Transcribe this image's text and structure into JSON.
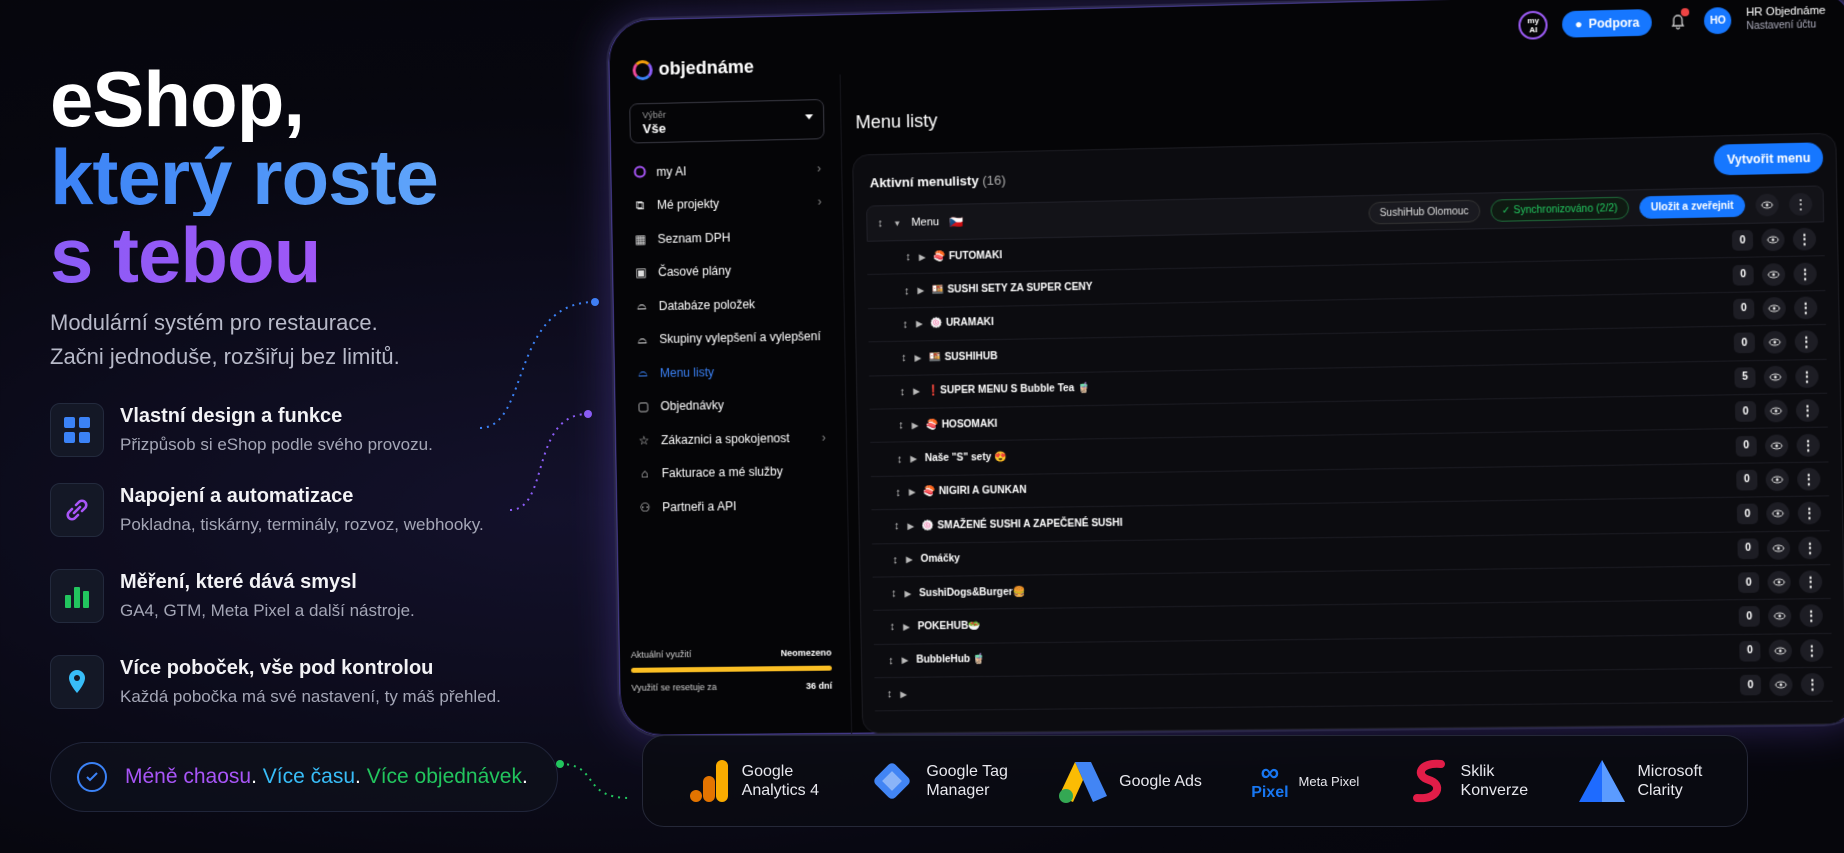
{
  "hero": {
    "line1": "eShop,",
    "line2": "který roste",
    "line3": "s tebou",
    "subtitle_1": "Modulární systém pro restaurace.",
    "subtitle_2": "Začni jednoduše, rozšiřuj bez limitů."
  },
  "features": [
    {
      "title": "Vlastní design a funkce",
      "desc": "Přizpůsob si eShop podle svého provozu.",
      "icon": "grid-icon",
      "color": "#3b82f6"
    },
    {
      "title": "Napojení a automatizace",
      "desc": "Pokladna, tiskárny, terminály, rozvoz, webhooky.",
      "icon": "link-icon",
      "color": "#a855f7"
    },
    {
      "title": "Měření, které dává smysl",
      "desc": "GA4, GTM, Meta Pixel a další nástroje.",
      "icon": "bar-chart-icon",
      "color": "#22c55e"
    },
    {
      "title": "Více poboček, vše pod kontrolou",
      "desc": "Každá pobočka má své nastavení, ty máš přehled.",
      "icon": "location-pin-icon",
      "color": "#38bdf8"
    }
  ],
  "tagline": {
    "p1": "Méně chaosu",
    "dot1": ".",
    "p2": "Více času",
    "dot2": ".",
    "p3": "Více objednávek",
    "dot3": "."
  },
  "app": {
    "logo": "objednáme",
    "topbar": {
      "myai_1": "my",
      "myai_2": "AI",
      "support": "Podpora",
      "avatar": "HO",
      "account_name": "HR Objednáme",
      "account_sub": "Nastavení účtu"
    },
    "select": {
      "label": "Výběr",
      "value": "Vše"
    },
    "nav": [
      {
        "label": "my AI",
        "icon": "ai-ring-icon",
        "chevron": true
      },
      {
        "label": "Mé projekty",
        "icon": "projects-icon",
        "chevron": true
      },
      {
        "label": "Seznam DPH",
        "icon": "table-icon",
        "chevron": false
      },
      {
        "label": "Časové plány",
        "icon": "calendar-icon",
        "chevron": false
      },
      {
        "label": "Databáze položek",
        "icon": "dish-icon",
        "chevron": false
      },
      {
        "label": "Skupiny vylepšení a vylepšení",
        "icon": "dish-plus-icon",
        "chevron": false
      },
      {
        "label": "Menu listy",
        "icon": "menu-list-icon",
        "chevron": false,
        "active": true
      },
      {
        "label": "Objednávky",
        "icon": "orders-icon",
        "chevron": false
      },
      {
        "label": "Zákaznici a spokojenost",
        "icon": "star-icon",
        "chevron": true
      },
      {
        "label": "Fakturace a mé služby",
        "icon": "store-icon",
        "chevron": false
      },
      {
        "label": "Partneři a API",
        "icon": "network-icon",
        "chevron": false
      }
    ],
    "usage": {
      "label": "Aktuální využití",
      "value": "Neomezeno",
      "reset_label": "Využití se resetuje za",
      "reset_value": "36 dní"
    },
    "page_title": "Menu listy",
    "panel": {
      "title": "Aktivní menulisty",
      "count": "(16)",
      "create": "Vytvořit menu"
    },
    "menu_header": {
      "label": "Menu",
      "flag": "🇨🇿",
      "branch": "SushiHub Olomouc",
      "sync": "Synchronizováno (2/2)",
      "save": "Uložit a zveřejnit"
    },
    "rows": [
      {
        "label": "🍣 FUTOMAKI",
        "count": "0"
      },
      {
        "label": "🍱 SUSHI SETY ZA SUPER CENY",
        "count": "0"
      },
      {
        "label": "🍥 URAMAKI",
        "count": "0"
      },
      {
        "label": "🍱 SUSHIHUB",
        "count": "0"
      },
      {
        "label": "❗SUPER MENU S Bubble Tea 🧋",
        "count": "5"
      },
      {
        "label": "🍣 HOSOMAKI",
        "count": "0"
      },
      {
        "label": "Naše \"S\" sety 😍",
        "count": "0"
      },
      {
        "label": "🍣 NIGIRI A GUNKAN",
        "count": "0"
      },
      {
        "label": "🍥 SMAŽENÉ SUSHI A ZAPEČENÉ SUSHI",
        "count": "0"
      },
      {
        "label": "Omáčky",
        "count": "0"
      },
      {
        "label": "SushiDogs&Burger🍔",
        "count": "0"
      },
      {
        "label": "POKEHUB🥗",
        "count": "0"
      },
      {
        "label": "BubbleHub 🧋",
        "count": "0"
      },
      {
        "label": "",
        "count": "0"
      }
    ]
  },
  "integrations": [
    {
      "l1": "Google",
      "l2": "Analytics 4",
      "icon": "google-analytics-icon"
    },
    {
      "l1": "Google Tag",
      "l2": "Manager",
      "icon": "google-tag-manager-icon"
    },
    {
      "l1": "Google Ads",
      "l2": "",
      "icon": "google-ads-icon"
    },
    {
      "l1": "Meta Pixel",
      "l2": "",
      "icon": "meta-icon",
      "sub": "Pixel"
    },
    {
      "l1": "Sklik",
      "l2": "Konverze",
      "icon": "sklik-icon"
    },
    {
      "l1": "Microsoft",
      "l2": "Clarity",
      "icon": "clarity-icon"
    }
  ],
  "colors": {
    "accent": "#1677ff",
    "purple": "#8b5cf6",
    "green": "#22c55e",
    "usage_bar": "#fbbf24"
  }
}
